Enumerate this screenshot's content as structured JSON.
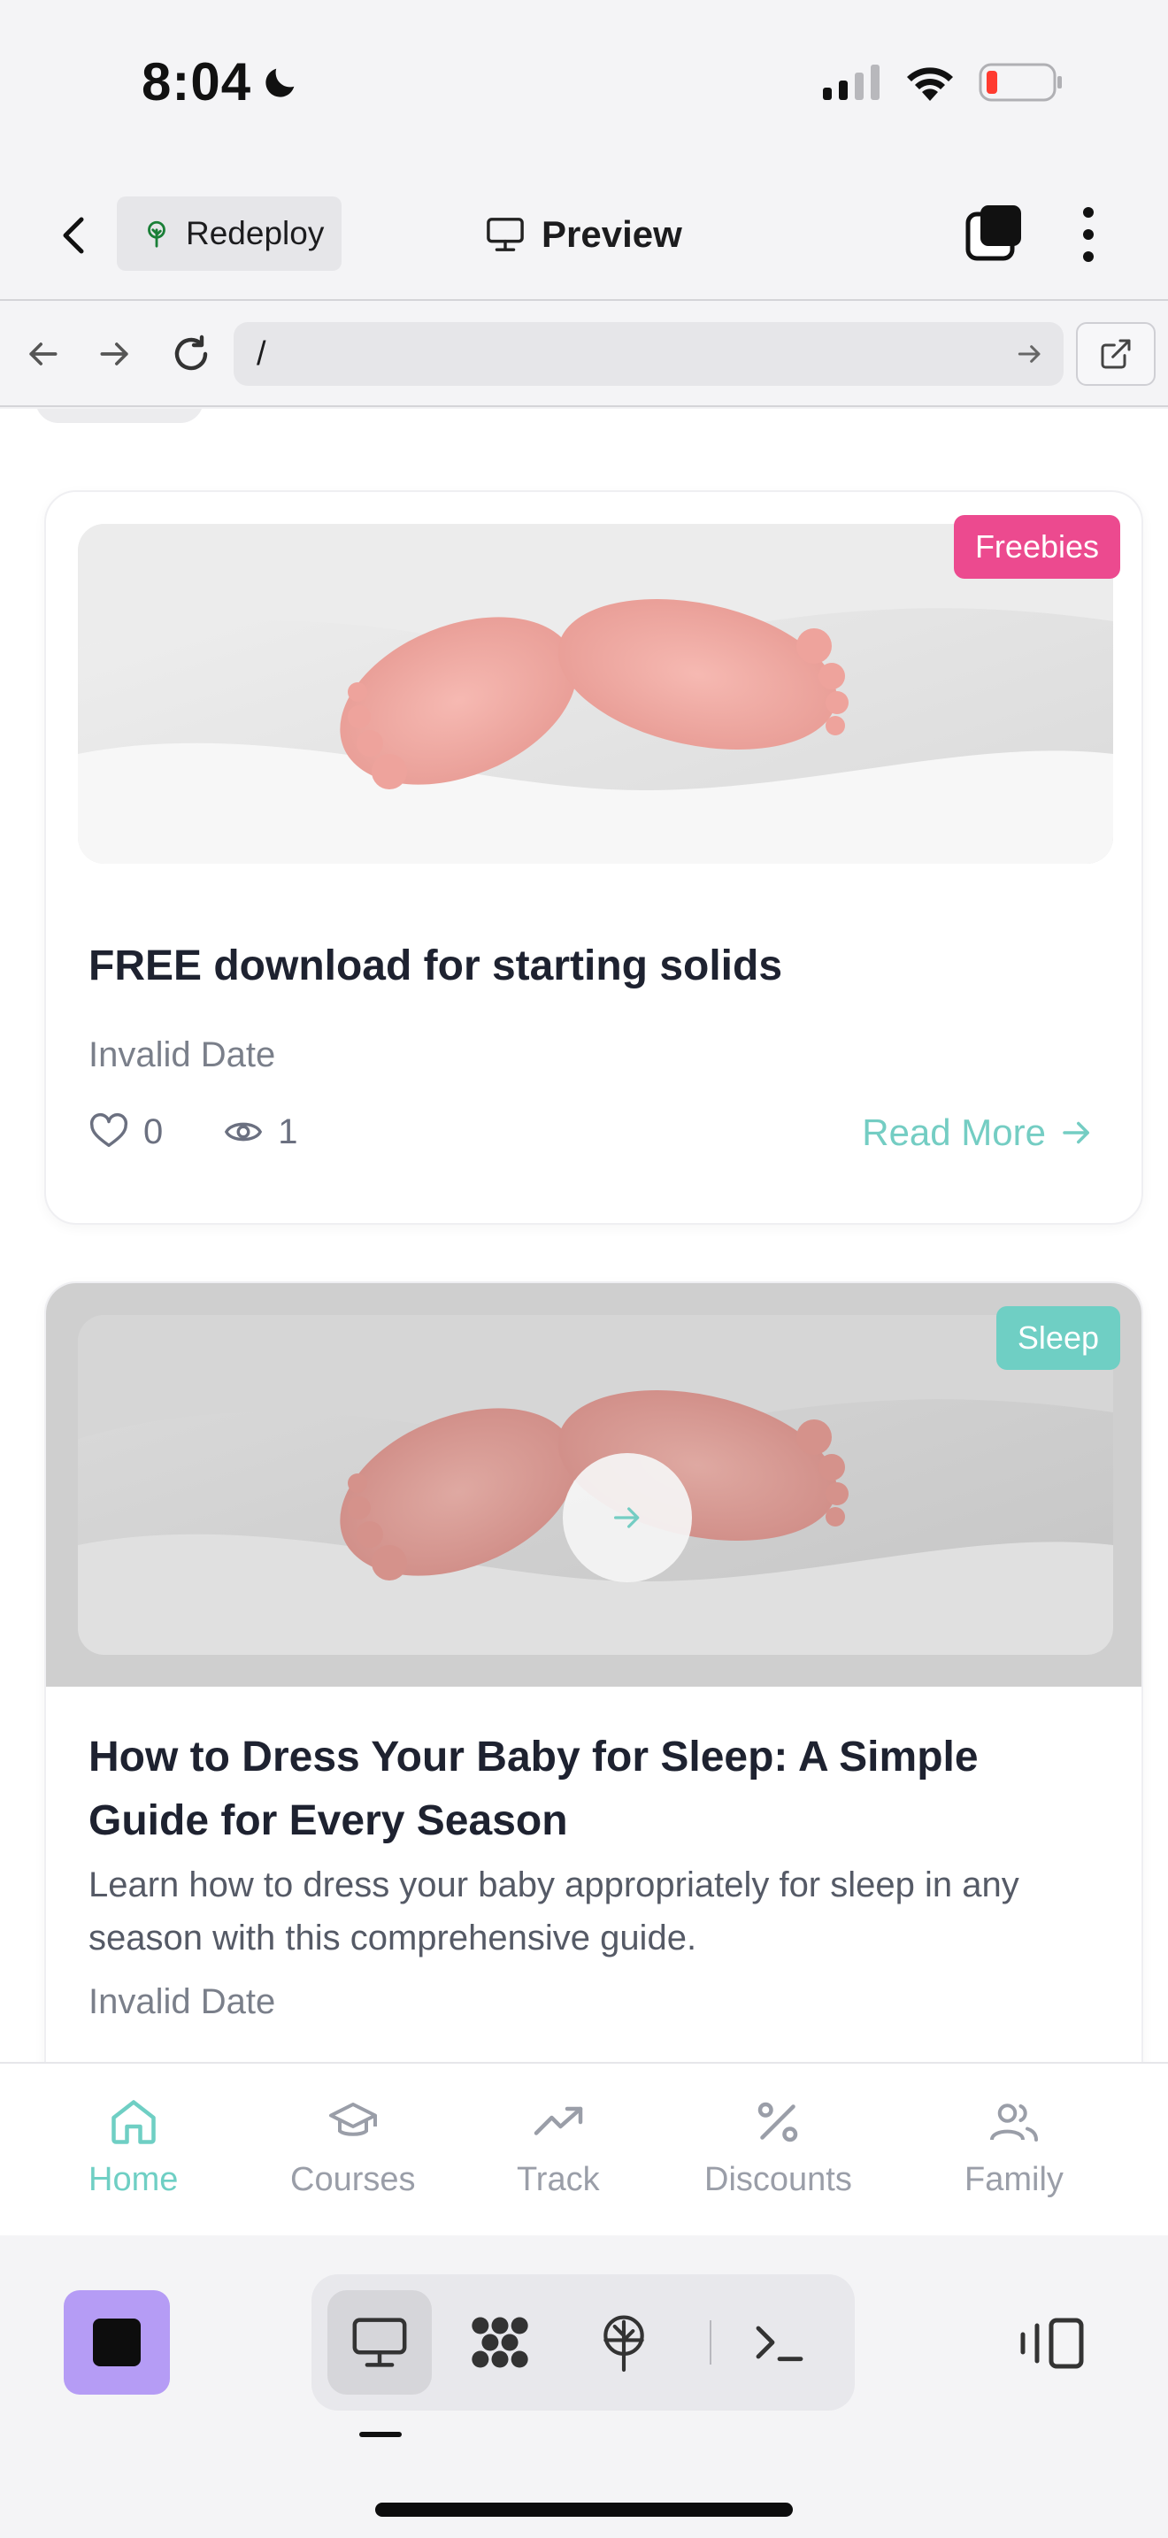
{
  "status_bar": {
    "time": "8:04",
    "icons": [
      "moon-icon",
      "cellular-signal-icon",
      "wifi-icon",
      "battery-low-icon"
    ]
  },
  "app_header": {
    "redeploy_label": "Redeploy",
    "preview_label": "Preview",
    "icons": [
      "back-icon",
      "deploy-tree-icon",
      "monitor-icon",
      "tabs-icon",
      "more-vertical-icon"
    ]
  },
  "url_bar": {
    "url": "/",
    "icons": [
      "nav-back-icon",
      "nav-forward-icon",
      "reload-icon",
      "go-arrow-icon",
      "open-external-icon"
    ]
  },
  "posts": [
    {
      "category": "Freebies",
      "category_color": "#ec4a8f",
      "title": "FREE download for starting solids",
      "date": "Invalid Date",
      "likes": "0",
      "views": "1",
      "read_more": "Read More"
    },
    {
      "category": "Sleep",
      "category_color": "#6fcfc4",
      "title": "How to Dress Your Baby for Sleep: A Simple Guide for Every Season",
      "description": "Learn how to dress your baby appropriately for sleep in any season with this comprehensive guide.",
      "date": "Invalid Date"
    }
  ],
  "bottom_nav": {
    "items": [
      {
        "label": "Home",
        "icon": "home-icon",
        "active": true
      },
      {
        "label": "Courses",
        "icon": "graduation-cap-icon",
        "active": false
      },
      {
        "label": "Track",
        "icon": "trending-up-icon",
        "active": false
      },
      {
        "label": "Discounts",
        "icon": "percent-icon",
        "active": false
      },
      {
        "label": "Family",
        "icon": "users-icon",
        "active": false
      }
    ]
  },
  "toolbar": {
    "icons": [
      "stop-icon",
      "monitor-icon",
      "apps-grid-icon",
      "deploy-tree-icon",
      "terminal-icon",
      "side-panel-icon"
    ],
    "active_tool": "monitor-icon"
  },
  "colors": {
    "accent": "#6fcfc4",
    "pink": "#ec4a8f",
    "stop_button": "#b59cf5"
  }
}
